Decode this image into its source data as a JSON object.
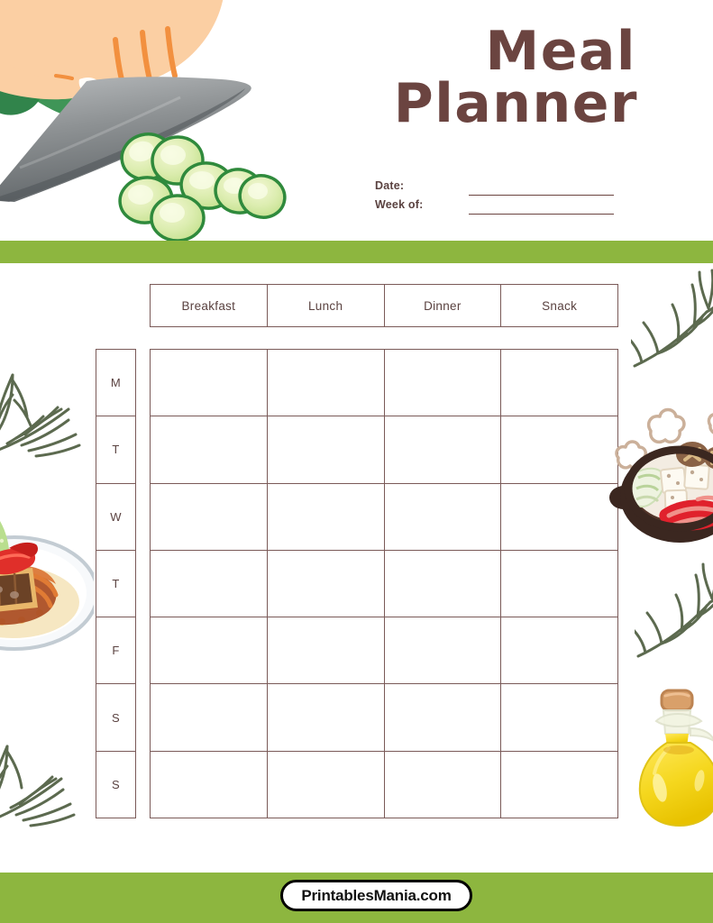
{
  "page": {
    "title": "Meal Planner",
    "background_color": "#ffffff",
    "accent_green": "#8db63f",
    "ink_brown": "#6b4440",
    "border_brown": "#7a5a58"
  },
  "header": {
    "title_line_1": "Meal",
    "title_line_2": "Planner",
    "fields": [
      {
        "label": "Date:",
        "value": ""
      },
      {
        "label": "Week of:",
        "value": ""
      }
    ]
  },
  "table": {
    "columns": [
      "Breakfast",
      "Lunch",
      "Dinner",
      "Snack"
    ],
    "days": [
      "M",
      "T",
      "W",
      "T",
      "F",
      "S",
      "S"
    ],
    "rows": [
      {
        "day": "M",
        "cells": [
          "",
          "",
          "",
          ""
        ]
      },
      {
        "day": "T",
        "cells": [
          "",
          "",
          "",
          ""
        ]
      },
      {
        "day": "W",
        "cells": [
          "",
          "",
          "",
          ""
        ]
      },
      {
        "day": "T",
        "cells": [
          "",
          "",
          "",
          ""
        ]
      },
      {
        "day": "F",
        "cells": [
          "",
          "",
          "",
          ""
        ]
      },
      {
        "day": "S",
        "cells": [
          "",
          "",
          "",
          ""
        ]
      },
      {
        "day": "S",
        "cells": [
          "",
          "",
          "",
          ""
        ]
      }
    ]
  },
  "decorations": {
    "header_illustration": "hand-slicing-cucumber-with-knife",
    "left_top": "rosemary-sprig",
    "left_middle": "katsu-curry-plate",
    "left_bottom": "rosemary-sprig",
    "right_top": "rosemary-sprig",
    "right_middle": "hot-pot-nabe-with-steam",
    "right_lower": "rosemary-sprig",
    "right_bottom": "olive-oil-bottle"
  },
  "footer": {
    "brand": "PrintablesMania.com"
  }
}
